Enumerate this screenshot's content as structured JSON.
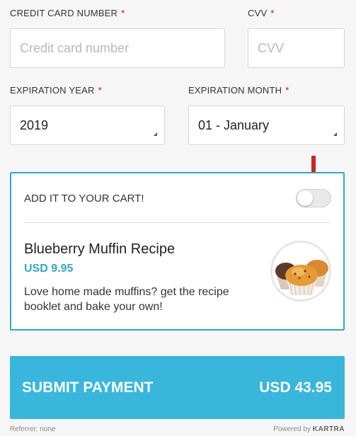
{
  "card_number": {
    "label": "CREDIT CARD NUMBER",
    "required": "*",
    "placeholder": "Credit card number",
    "value": ""
  },
  "cvv": {
    "label": "CVV",
    "required": "*",
    "placeholder": "CVV",
    "value": ""
  },
  "expiration_year": {
    "label": "EXPIRATION YEAR",
    "required": "*",
    "selected": "2019"
  },
  "expiration_month": {
    "label": "EXPIRATION MONTH",
    "required": "*",
    "selected": "01 - January"
  },
  "cart_offer": {
    "title": "ADD IT TO YOUR CART!",
    "toggle_on": false,
    "product_name": "Blueberry Muffin Recipe",
    "price": "USD 9.95",
    "description": "Love home made muffins? get the recipe booklet and bake your own!",
    "image_icon": "muffin-image",
    "accent_color": "#31a8c9",
    "arrow_color": "#c62828"
  },
  "submit": {
    "label": "SUBMIT PAYMENT",
    "amount": "USD 43.95",
    "color": "#38b6dc"
  },
  "footer": {
    "referrer": "Referrer: none",
    "powered_prefix": "Powered by",
    "powered_brand": "KARTRA"
  }
}
